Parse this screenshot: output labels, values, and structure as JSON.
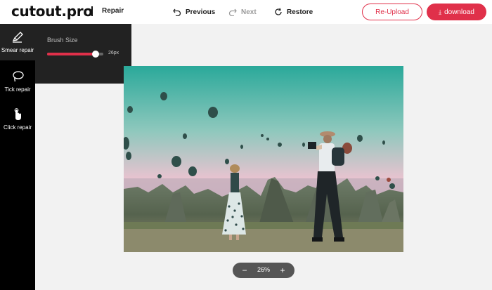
{
  "header": {
    "logo": "cutout.pro",
    "mode": "Repair",
    "previous_label": "Previous",
    "next_label": "Next",
    "restore_label": "Restore",
    "reupload_label": "Re-Upload",
    "download_label": "download"
  },
  "sidebar": {
    "tools": [
      {
        "label": "Smear repair",
        "icon": "brush-icon",
        "active": true
      },
      {
        "label": "Tick repair",
        "icon": "lasso-icon",
        "active": false
      },
      {
        "label": "Click repair",
        "icon": "pointer-icon",
        "active": false
      }
    ]
  },
  "brush": {
    "title": "Brush Size",
    "value_label": "26px",
    "fraction": 0.86
  },
  "zoom": {
    "value": "26%",
    "minus": "−",
    "plus": "+"
  },
  "colors": {
    "accent": "#e0304a",
    "sidebar": "#000000",
    "panel": "#222222",
    "canvas_bg": "#f2f2f2"
  }
}
